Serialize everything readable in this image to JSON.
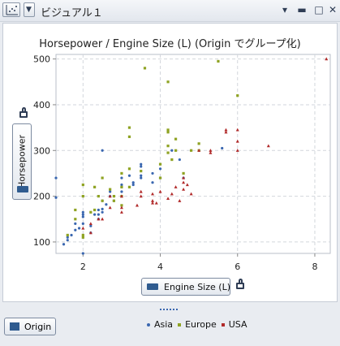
{
  "window": {
    "title": "ビジュアル１"
  },
  "chart_data": {
    "type": "scatter",
    "title": "Horsepower / Engine Size (L) (Origin でグループ化)",
    "xlabel": "Engine Size (L)",
    "ylabel": "Horsepower",
    "xlim": [
      1.3,
      8.4
    ],
    "ylim": [
      75,
      510
    ],
    "xticks": [
      2,
      4,
      6,
      8
    ],
    "yticks": [
      100,
      200,
      300,
      400,
      500
    ],
    "grid": true,
    "legend_position": "bottom",
    "legend_title": "Origin",
    "series": [
      {
        "name": "Asia",
        "color": "#3a67b0",
        "points": [
          [
            1.3,
            240
          ],
          [
            1.3,
            197
          ],
          [
            1.5,
            95
          ],
          [
            1.6,
            104
          ],
          [
            1.6,
            110
          ],
          [
            1.7,
            115
          ],
          [
            1.8,
            126
          ],
          [
            1.8,
            140
          ],
          [
            1.9,
            130
          ],
          [
            2.0,
            155
          ],
          [
            2.0,
            160
          ],
          [
            2.0,
            165
          ],
          [
            2.0,
            140
          ],
          [
            2.0,
            75
          ],
          [
            2.2,
            135
          ],
          [
            2.2,
            120
          ],
          [
            2.3,
            160
          ],
          [
            2.4,
            150
          ],
          [
            2.4,
            160
          ],
          [
            2.4,
            170
          ],
          [
            2.5,
            165
          ],
          [
            2.5,
            172
          ],
          [
            2.5,
            190
          ],
          [
            2.6,
            182
          ],
          [
            2.7,
            200
          ],
          [
            2.7,
            210
          ],
          [
            2.8,
            190
          ],
          [
            3.0,
            210
          ],
          [
            3.0,
            200
          ],
          [
            3.0,
            220
          ],
          [
            3.0,
            225
          ],
          [
            3.0,
            240
          ],
          [
            3.2,
            245
          ],
          [
            3.3,
            225
          ],
          [
            3.3,
            230
          ],
          [
            3.5,
            240
          ],
          [
            3.5,
            245
          ],
          [
            3.5,
            265
          ],
          [
            3.5,
            270
          ],
          [
            3.8,
            230
          ],
          [
            3.8,
            250
          ],
          [
            4.0,
            260
          ],
          [
            4.0,
            240
          ],
          [
            4.3,
            300
          ],
          [
            4.5,
            280
          ],
          [
            4.6,
            240
          ],
          [
            5.6,
            305
          ],
          [
            2.5,
            300
          ]
        ]
      },
      {
        "name": "Europe",
        "color": "#8fa323",
        "points": [
          [
            1.6,
            115
          ],
          [
            1.8,
            150
          ],
          [
            1.8,
            170
          ],
          [
            2.0,
            200
          ],
          [
            2.0,
            225
          ],
          [
            2.0,
            110
          ],
          [
            2.0,
            115
          ],
          [
            2.2,
            165
          ],
          [
            2.3,
            170
          ],
          [
            2.3,
            220
          ],
          [
            2.4,
            200
          ],
          [
            2.5,
            190
          ],
          [
            2.5,
            240
          ],
          [
            2.7,
            215
          ],
          [
            2.8,
            190
          ],
          [
            2.8,
            200
          ],
          [
            3.0,
            180
          ],
          [
            3.0,
            200
          ],
          [
            3.0,
            220
          ],
          [
            3.0,
            250
          ],
          [
            3.2,
            220
          ],
          [
            3.2,
            260
          ],
          [
            3.2,
            330
          ],
          [
            3.2,
            350
          ],
          [
            3.5,
            255
          ],
          [
            3.6,
            480
          ],
          [
            4.0,
            240
          ],
          [
            4.0,
            270
          ],
          [
            4.2,
            295
          ],
          [
            4.2,
            310
          ],
          [
            4.2,
            340
          ],
          [
            4.2,
            345
          ],
          [
            4.3,
            280
          ],
          [
            4.4,
            300
          ],
          [
            4.4,
            325
          ],
          [
            4.6,
            250
          ],
          [
            4.8,
            300
          ],
          [
            5.0,
            300
          ],
          [
            5.0,
            315
          ],
          [
            5.5,
            495
          ],
          [
            6.0,
            420
          ],
          [
            4.2,
            450
          ]
        ]
      },
      {
        "name": "USA",
        "color": "#b12a2a",
        "points": [
          [
            2.0,
            130
          ],
          [
            2.2,
            120
          ],
          [
            2.2,
            140
          ],
          [
            2.4,
            150
          ],
          [
            2.5,
            150
          ],
          [
            2.7,
            175
          ],
          [
            2.7,
            200
          ],
          [
            3.0,
            165
          ],
          [
            3.0,
            175
          ],
          [
            3.0,
            200
          ],
          [
            3.4,
            180
          ],
          [
            3.5,
            200
          ],
          [
            3.5,
            210
          ],
          [
            3.8,
            185
          ],
          [
            3.8,
            190
          ],
          [
            3.8,
            205
          ],
          [
            3.9,
            185
          ],
          [
            4.0,
            210
          ],
          [
            4.2,
            195
          ],
          [
            4.3,
            205
          ],
          [
            4.4,
            220
          ],
          [
            4.5,
            190
          ],
          [
            4.6,
            215
          ],
          [
            4.6,
            230
          ],
          [
            4.6,
            240
          ],
          [
            5.0,
            300
          ],
          [
            5.3,
            295
          ],
          [
            5.3,
            300
          ],
          [
            5.7,
            340
          ],
          [
            5.7,
            345
          ],
          [
            6.0,
            300
          ],
          [
            6.0,
            320
          ],
          [
            6.0,
            345
          ],
          [
            6.8,
            310
          ],
          [
            8.3,
            500
          ],
          [
            4.7,
            225
          ],
          [
            4.8,
            205
          ]
        ]
      }
    ]
  }
}
